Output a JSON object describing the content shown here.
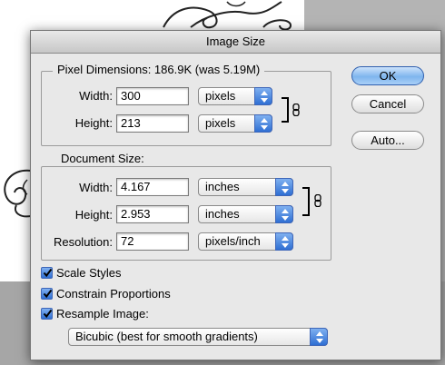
{
  "dialog": {
    "title": "Image Size"
  },
  "pixel_dimensions": {
    "legend": "Pixel Dimensions:  186.9K (was 5.19M)",
    "width_label": "Width:",
    "width_value": "300",
    "width_unit": "pixels",
    "height_label": "Height:",
    "height_value": "213",
    "height_unit": "pixels"
  },
  "document_size": {
    "legend": "Document Size:",
    "width_label": "Width:",
    "width_value": "4.167",
    "width_unit": "inches",
    "height_label": "Height:",
    "height_value": "2.953",
    "height_unit": "inches",
    "resolution_label": "Resolution:",
    "resolution_value": "72",
    "resolution_unit": "pixels/inch"
  },
  "buttons": {
    "ok": "OK",
    "cancel": "Cancel",
    "auto": "Auto..."
  },
  "options": {
    "scale_styles": {
      "label": "Scale Styles",
      "checked": true
    },
    "constrain_proportions": {
      "label": "Constrain Proportions",
      "checked": true
    },
    "resample_image": {
      "label": "Resample Image:",
      "checked": true
    },
    "resample_method": "Bicubic (best for smooth gradients)"
  },
  "icons": {
    "pixel_link": "chain-link-icon",
    "document_link": "chain-link-icon",
    "popup_arrows": "up-down-arrows-icon",
    "checkmark": "checkmark-icon"
  },
  "colors": {
    "accent": "#2f6fd3",
    "dialog_bg": "#e8e8e8"
  }
}
